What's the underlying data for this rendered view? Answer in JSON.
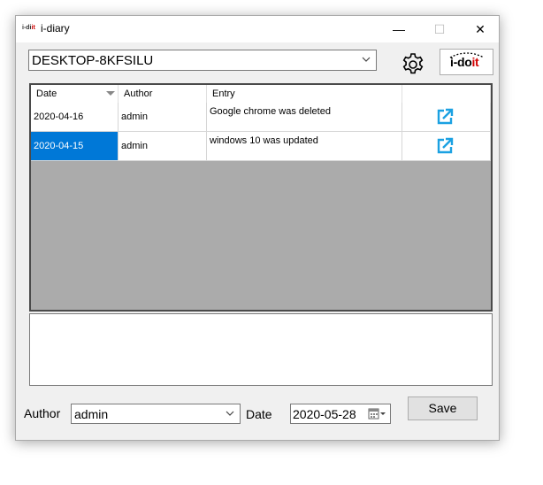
{
  "window": {
    "title": "i-diary",
    "icon_text_a": "i-di",
    "icon_text_b": "it",
    "minimize_symbol": "—",
    "maximize_symbol": "☐",
    "close_symbol": "✕"
  },
  "toolbar": {
    "computer_value": "DESKTOP-8KFSILU",
    "settings_icon": "gear-icon",
    "logo_text_a": "i-do",
    "logo_text_b": "it"
  },
  "grid": {
    "columns": [
      "Date",
      "Author",
      "Entry",
      ""
    ],
    "rows": [
      {
        "date": "2020-04-16",
        "author": "admin",
        "entry": "Google chrome was deleted",
        "selected": false
      },
      {
        "date": "2020-04-15",
        "author": "admin",
        "entry": "windows 10 was updated",
        "selected": true
      }
    ],
    "row_action_icon": "open-external-icon",
    "accent_color": "#1ba1e2",
    "selection_color": "#0078d7"
  },
  "detail": {
    "text": ""
  },
  "footer": {
    "author_label": "Author",
    "author_value": "admin",
    "date_label": "Date",
    "date_value": "2020-05-28",
    "save_label": "Save"
  }
}
